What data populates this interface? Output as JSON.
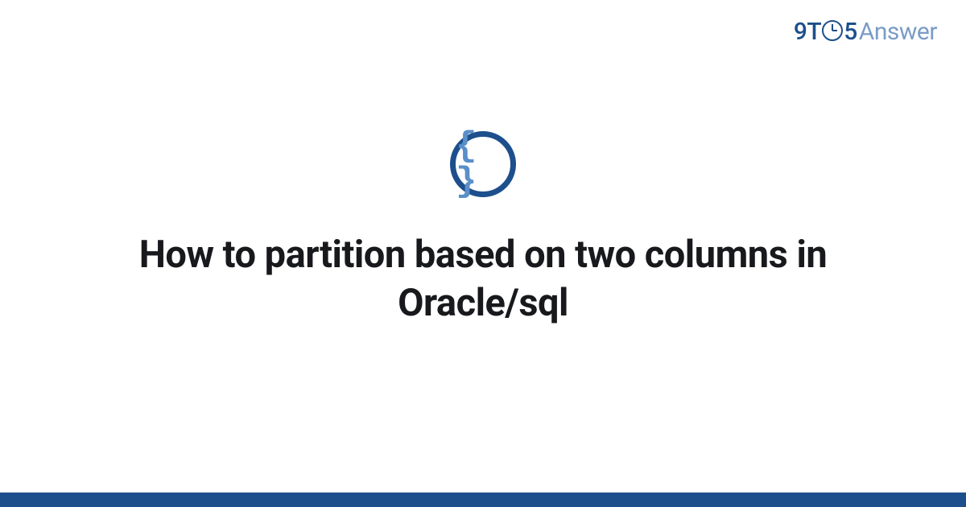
{
  "brand": {
    "part1": "9T",
    "part2": "5",
    "part3": "Answer"
  },
  "icon": {
    "glyph": "{ }",
    "semantic": "code-braces"
  },
  "main": {
    "title": "How to partition based on two columns in Oracle/sql"
  },
  "colors": {
    "primary": "#1d4f8c",
    "secondary": "#5a8fc9",
    "muted": "#7a9cc6",
    "text": "#17191c"
  }
}
